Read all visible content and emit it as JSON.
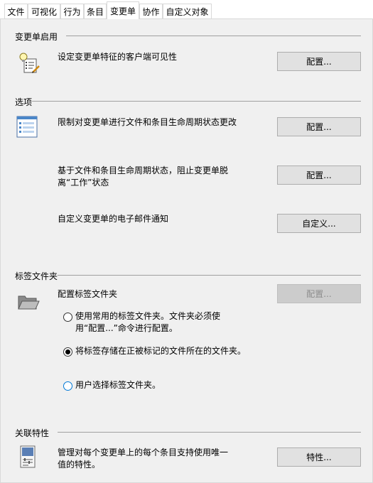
{
  "tabs": [
    {
      "label": "文件"
    },
    {
      "label": "可视化"
    },
    {
      "label": "行为"
    },
    {
      "label": "条目"
    },
    {
      "label": "变更单",
      "active": true
    },
    {
      "label": "协作"
    },
    {
      "label": "自定义对象"
    }
  ],
  "sections": {
    "enable": {
      "title": "变更单启用",
      "icon": "lightbulb-checklist-icon",
      "description": "设定变更单特征的客户端可见性",
      "button": "配置..."
    },
    "options": {
      "title": "选项",
      "icon": "list-form-icon",
      "items": [
        {
          "description": "限制对变更单进行文件和条目生命周期状态更改",
          "button": "配置..."
        },
        {
          "description": "基于文件和条目生命周期状态，阻止变更单脱离“工作”状态",
          "button": "配置..."
        },
        {
          "description": "自定义变更单的电子邮件通知",
          "button": "自定义..."
        }
      ]
    },
    "markup": {
      "title": "标签文件夹",
      "icon": "open-folder-icon",
      "description": "配置标签文件夹",
      "button": "配置...",
      "button_disabled": true,
      "radios": [
        {
          "label": "使用常用的标签文件夹。文件夹必须使用“配置...”命令进行配置。",
          "checked": false
        },
        {
          "label": "将标签存储在正被标记的文件所在的文件夹。",
          "checked": true
        },
        {
          "label": "用户选择标签文件夹。",
          "checked": false,
          "focused": true
        }
      ]
    },
    "linked": {
      "title": "关联特性",
      "icon": "properties-icon",
      "description": "管理对每个变更单上的每个条目支持使用唯一值的特性。",
      "button": "特性..."
    }
  },
  "colors": {
    "panel_bg": "#f0f0f0",
    "button_bg": "#e1e1e1",
    "focus_blue": "#0078d7"
  }
}
